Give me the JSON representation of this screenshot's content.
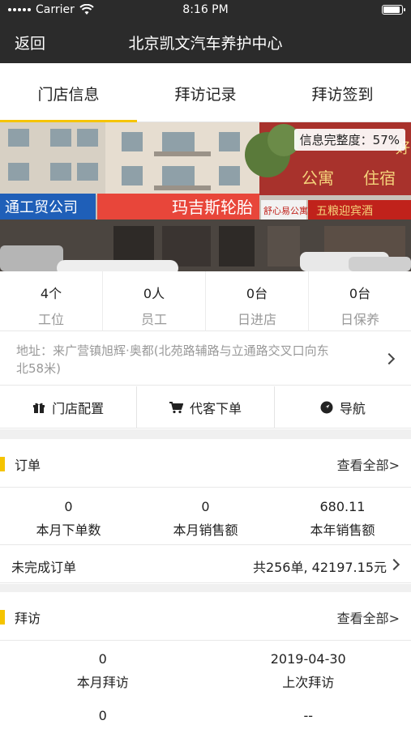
{
  "status_bar": {
    "carrier": "Carrier",
    "time": "8:16 PM"
  },
  "nav": {
    "back": "返回",
    "title": "北京凯文汽车养护中心"
  },
  "tabs": [
    {
      "label": "门店信息",
      "active": true
    },
    {
      "label": "拜访记录",
      "active": false
    },
    {
      "label": "拜访签到",
      "active": false
    }
  ],
  "hero": {
    "completeness": "信息完整度：57%",
    "signs": [
      "通工贸公司",
      "玛吉斯轮胎",
      "舒心易公寓",
      "公寓",
      "住宿",
      "五粮迎宾酒",
      "好"
    ]
  },
  "stats": [
    {
      "value": "4个",
      "label": "工位"
    },
    {
      "value": "0人",
      "label": "员工"
    },
    {
      "value": "0台",
      "label": "日进店"
    },
    {
      "value": "0台",
      "label": "日保养"
    }
  ],
  "address": {
    "line1": "地址：来广营镇旭辉·奥都(北苑路辅路与立通路交叉口向东",
    "line2": "北58米)"
  },
  "actions": [
    {
      "label": "门店配置",
      "icon": "gift-icon"
    },
    {
      "label": "代客下单",
      "icon": "cart-icon"
    },
    {
      "label": "导航",
      "icon": "navigation-icon"
    }
  ],
  "orders": {
    "title": "订单",
    "more": "查看全部>",
    "stats": [
      {
        "value": "0",
        "label": "本月下单数"
      },
      {
        "value": "0",
        "label": "本月销售额"
      },
      {
        "value": "680.11",
        "label": "本年销售额"
      }
    ],
    "unfinished_label": "未完成订单",
    "unfinished_value": "共256单, 42197.15元"
  },
  "visits": {
    "title": "拜访",
    "more": "查看全部>",
    "stats": [
      {
        "value": "0",
        "label": "本月拜访"
      },
      {
        "value": "2019-04-30",
        "label": "上次拜访"
      }
    ],
    "extra": [
      {
        "value": "0"
      },
      {
        "value": "--"
      }
    ]
  },
  "colors": {
    "nav_bg": "#2b2b2b",
    "accent": "#f5c400"
  }
}
